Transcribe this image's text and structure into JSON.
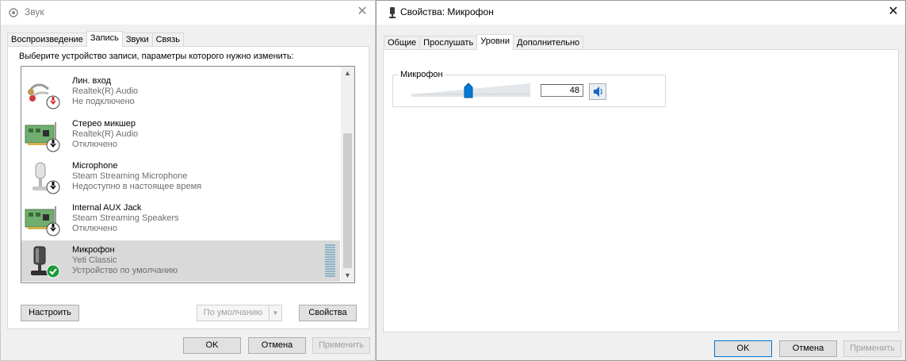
{
  "sound": {
    "title": "Звук",
    "tabs": [
      "Воспроизведение",
      "Запись",
      "Звуки",
      "Связь"
    ],
    "instruction": "Выберите устройство записи, параметры которого нужно изменить:",
    "devices": [
      {
        "name": "Лин. вход",
        "driver": "Realtek(R) Audio",
        "status": "Не подключено",
        "icon": "line-in-jack-icon"
      },
      {
        "name": "Стерео микшер",
        "driver": "Realtek(R) Audio",
        "status": "Отключено",
        "icon": "sound-card-icon"
      },
      {
        "name": "Microphone",
        "driver": "Steam Streaming Microphone",
        "status": "Недоступно в настоящее время",
        "icon": "microphone-icon"
      },
      {
        "name": "Internal AUX Jack",
        "driver": "Steam Streaming Speakers",
        "status": "Отключено",
        "icon": "sound-card-icon"
      },
      {
        "name": "Микрофон",
        "driver": "Yeti Classic",
        "status": "Устройство по умолчанию",
        "icon": "microphone-icon"
      }
    ],
    "configure_label": "Настроить",
    "default_label": "По умолчанию",
    "properties_label": "Свойства",
    "ok_label": "OK",
    "cancel_label": "Отмена",
    "apply_label": "Применить"
  },
  "props": {
    "title": "Свойства: Микрофон",
    "tabs": [
      "Общие",
      "Прослушать",
      "Уровни",
      "Дополнительно"
    ],
    "level_group_label": "Микрофон",
    "level_value": "48",
    "slider_level": 0.48,
    "ok_label": "OK",
    "cancel_label": "Отмена",
    "apply_label": "Применить"
  },
  "colors": {
    "accent": "#0078d7",
    "selection": "#d9d9d9",
    "status_ok": "#1e9b3a",
    "status_error": "#d62b2b"
  }
}
